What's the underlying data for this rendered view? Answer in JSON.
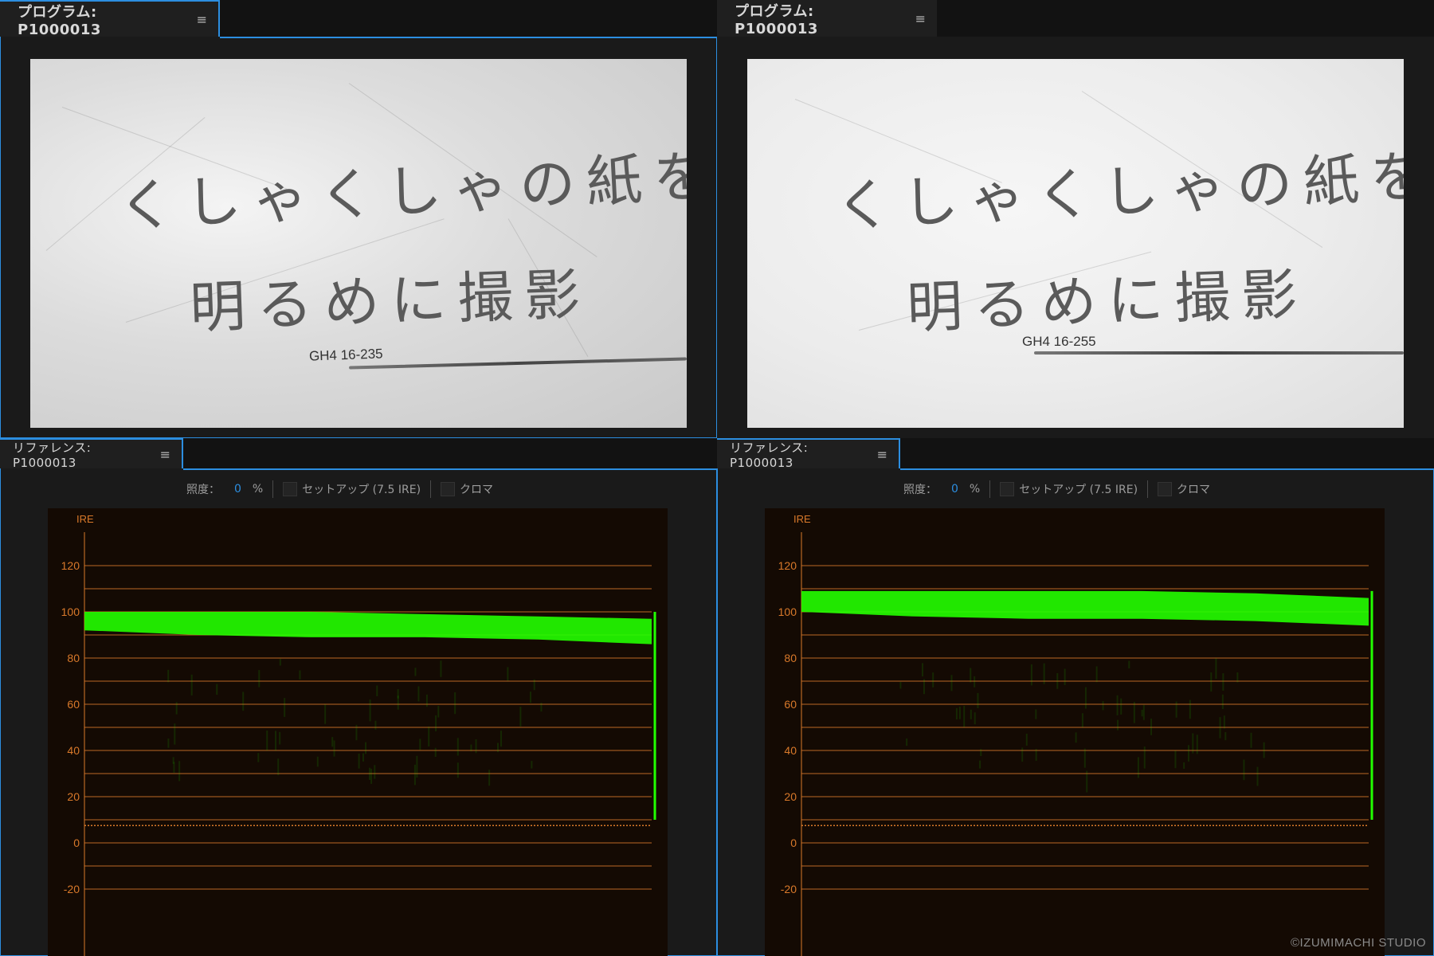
{
  "program_panels": [
    {
      "tab_title": "プログラム: P1000013",
      "line1": "くしゃくしゃの紙を",
      "line2": "明るめに撮影",
      "label": "GH4 16-235"
    },
    {
      "tab_title": "プログラム: P1000013",
      "line1": "くしゃくしゃの紙を",
      "line2": "明るめに撮影",
      "label": "GH4 16-255"
    }
  ],
  "reference_panels": [
    {
      "tab_title": "リファレンス: P1000013"
    },
    {
      "tab_title": "リファレンス: P1000013"
    }
  ],
  "toolbar": {
    "brightness_label": "照度：",
    "brightness_value": "0",
    "brightness_unit": "%",
    "setup_label": "セットアップ (7.5 IRE)",
    "chroma_label": "クロマ"
  },
  "menu_icon": "≡",
  "scope": {
    "unit_label": "IRE",
    "ticks": [
      "120",
      "100",
      "80",
      "60",
      "40",
      "20",
      "0",
      "-20"
    ]
  },
  "colors": {
    "accent": "#2c8ee0",
    "waveform": "#22ff00",
    "graticule": "#d9792a"
  },
  "watermark": "©IZUMIMACHI STUDIO",
  "chart_data": [
    {
      "type": "area",
      "title": "",
      "xlabel": "",
      "ylabel": "IRE",
      "ylim": [
        -25,
        125
      ],
      "series": [
        {
          "name": "",
          "band_top": [
            100,
            100,
            100,
            99,
            98,
            97
          ],
          "band_bottom": [
            92,
            90,
            89,
            89,
            88,
            86
          ]
        }
      ]
    },
    {
      "type": "area",
      "title": "",
      "xlabel": "",
      "ylabel": "IRE",
      "ylim": [
        -25,
        125
      ],
      "series": [
        {
          "name": "",
          "band_top": [
            109,
            109,
            109,
            109,
            108,
            106
          ],
          "band_bottom": [
            100,
            98,
            97,
            97,
            96,
            94
          ]
        }
      ]
    }
  ]
}
